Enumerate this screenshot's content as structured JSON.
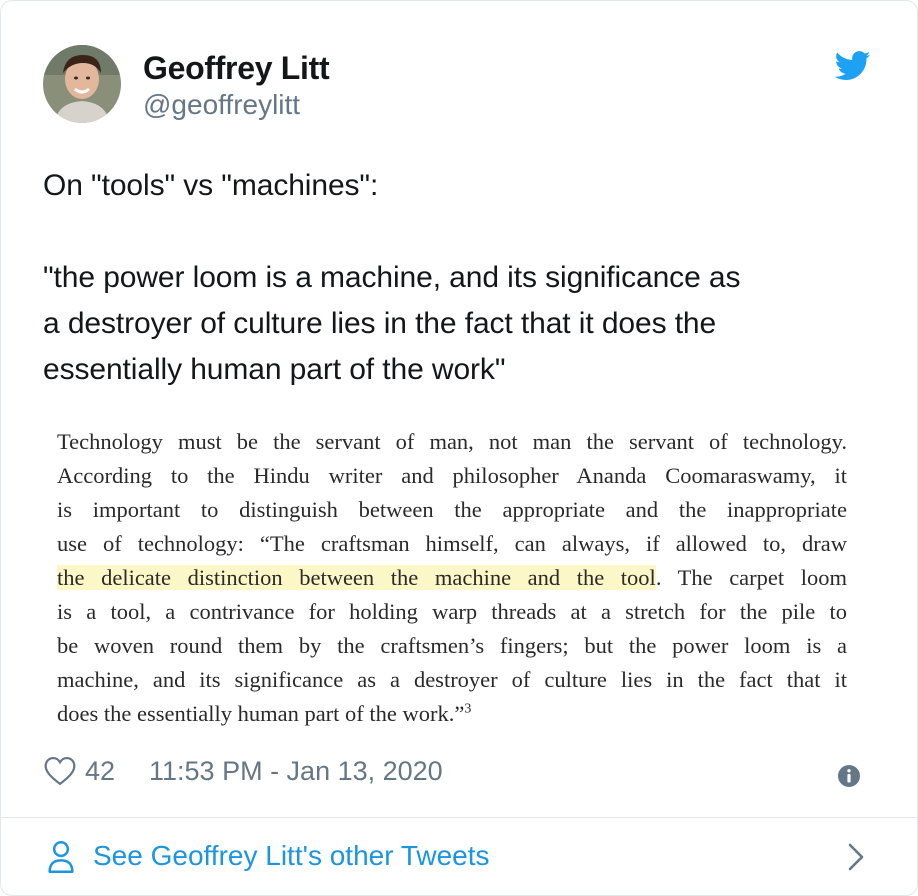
{
  "author": {
    "name": "Geoffrey Litt",
    "handle": "@geoffreylitt"
  },
  "tweet": {
    "intro": "On \"tools\" vs \"machines\":",
    "quote_line1": "\"the power loom is a machine, and its significance as",
    "quote_line2": "a destroyer of culture lies in the fact that it does the",
    "quote_line3": "essentially human part of the work\""
  },
  "book_excerpt": {
    "line1": "Technology must be the servant of man, not man the servant of technology.",
    "line2": "According to the Hindu writer and philosopher Ananda Coomaraswamy, it",
    "line3": "is important to distinguish between the appropriate and the inappropriate",
    "line4": "use of technology: “The craftsman himself, can always, if allowed to, draw",
    "line5_highlight": "the delicate distinction between the machine and the tool",
    "line5_rest": ". The carpet loom",
    "line6": "is a tool, a contrivance for holding warp threads at a stretch for the pile to",
    "line7": "be woven round them by the craftsmen’s fingers; but the power loom is a",
    "line8": "machine, and its significance as a destroyer of culture lies in the fact that it",
    "line9": "does the essentially human part of the work.”",
    "footnote": "3",
    "highlight_color": "#fcf7c6"
  },
  "meta": {
    "likes": "42",
    "timestamp": "11:53 PM - Jan 13, 2020"
  },
  "footer": {
    "more_tweets_label": "See Geoffrey Litt's other Tweets"
  },
  "icons": {
    "bird": "twitter-bird-icon",
    "heart": "heart-icon",
    "info": "info-icon",
    "user": "user-icon",
    "chevron": "chevron-right-icon"
  },
  "colors": {
    "brand_blue": "#1da1f2",
    "link_blue": "#1b95e0",
    "secondary_text": "#657786",
    "primary_text": "#14171a",
    "border": "#e1e8ed"
  }
}
